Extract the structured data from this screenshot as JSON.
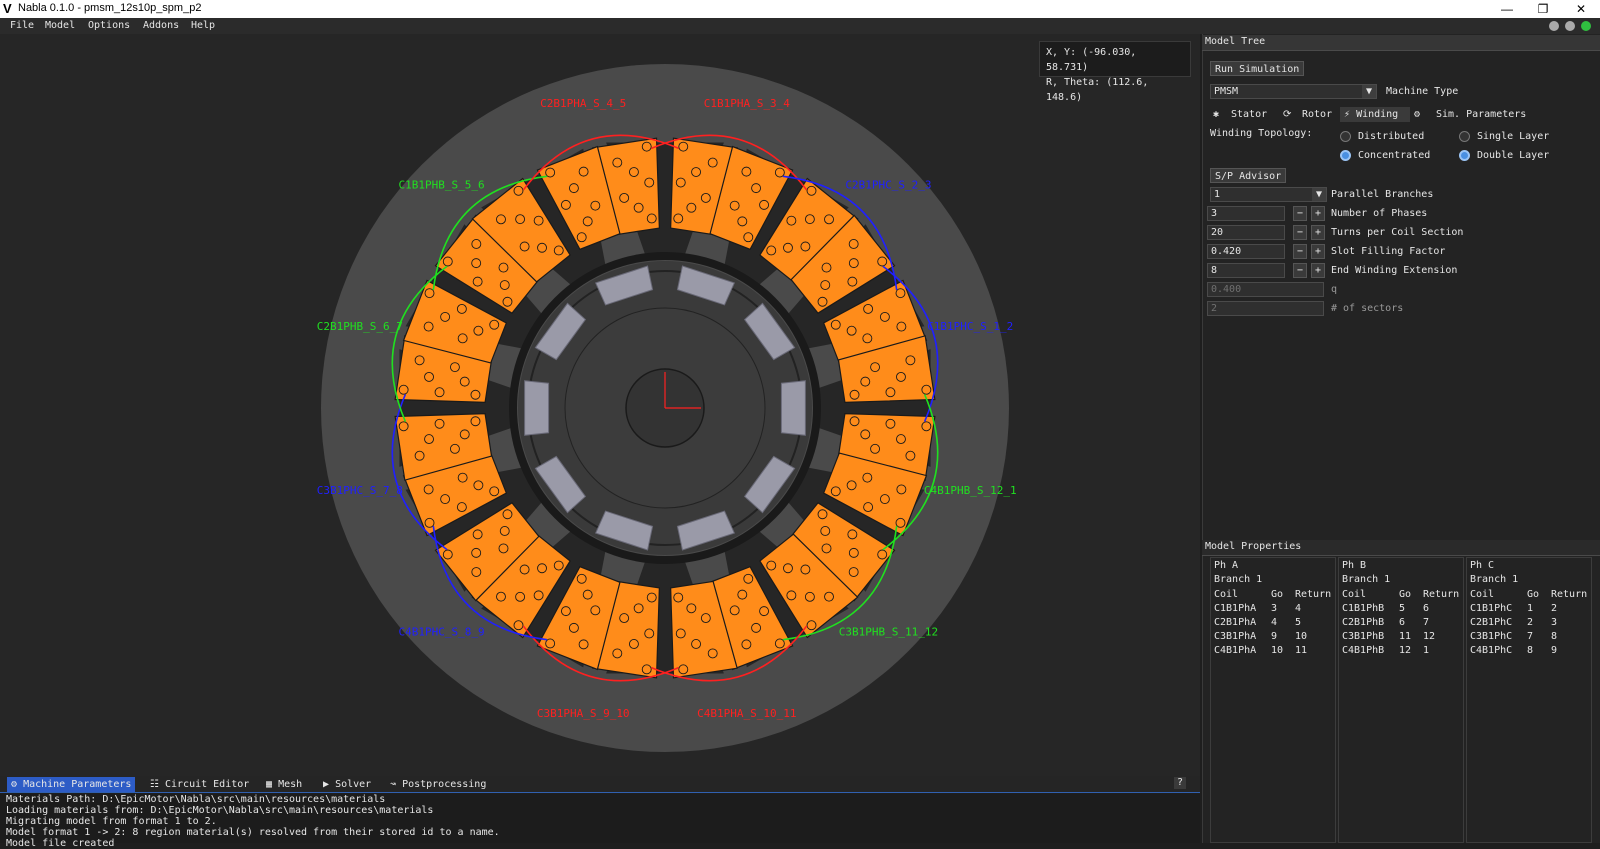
{
  "window": {
    "title": "Nabla 0.1.0 - pmsm_12s10p_spm_p2",
    "logo": "V"
  },
  "menu": [
    "File",
    "Model",
    "Options",
    "Addons",
    "Help"
  ],
  "coords": {
    "xy": "X, Y: (-96.030, 58.731)",
    "rtheta": "R, Theta: (112.6, 148.6)"
  },
  "coils": [
    {
      "label": "C1B1PHA_S_3_4",
      "color": "#ff2020"
    },
    {
      "label": "C2B1PHC_S_2_3",
      "color": "#2020ff"
    },
    {
      "label": "C1B1PHC_S_1_2",
      "color": "#2020ff"
    },
    {
      "label": "C4B1PHB_S_12_1",
      "color": "#20e020"
    },
    {
      "label": "C3B1PHB_S_11_12",
      "color": "#20e020"
    },
    {
      "label": "C4B1PHA_S_10_11",
      "color": "#ff2020"
    },
    {
      "label": "C3B1PHA_S_9_10",
      "color": "#ff2020"
    },
    {
      "label": "C4B1PHC_S_8_9",
      "color": "#2020ff"
    },
    {
      "label": "C3B1PHC_S_7_8",
      "color": "#2020ff"
    },
    {
      "label": "C2B1PHB_S_6_7",
      "color": "#20e020"
    },
    {
      "label": "C1B1PHB_S_5_6",
      "color": "#20e020"
    },
    {
      "label": "C2B1PHA_S_4_5",
      "color": "#ff2020"
    }
  ],
  "model_tree": {
    "title": "Model Tree",
    "run_button": "Run Simulation",
    "machine_type_value": "PMSM",
    "machine_type_label": "Machine Type",
    "tabs": {
      "stator": "Stator",
      "rotor": "Rotor",
      "winding": "Winding",
      "sim": "Sim. Parameters"
    },
    "topology_label": "Winding Topology:",
    "radios": {
      "distributed": "Distributed",
      "concentrated": "Concentrated",
      "single": "Single Layer",
      "double": "Double Layer"
    },
    "sp_advisor": "S/P Advisor",
    "parallel_value": "1",
    "parallel_label": "Parallel Branches",
    "params": [
      {
        "value": "3",
        "label": "Number of Phases"
      },
      {
        "value": "20",
        "label": "Turns per Coil Section"
      },
      {
        "value": "0.420",
        "label": "Slot Filling Factor"
      },
      {
        "value": "8",
        "label": "End Winding Extension"
      }
    ],
    "readonly": [
      {
        "value": "0.400",
        "label": "q"
      },
      {
        "value": "2",
        "label": "# of sectors"
      }
    ]
  },
  "model_properties": {
    "title": "Model Properties",
    "headers": {
      "coil": "Coil",
      "go": "Go",
      "ret": "Return"
    },
    "phases": [
      {
        "name": "Ph A",
        "branch": "Branch 1",
        "rows": [
          [
            "C1B1PhA",
            "3",
            "4"
          ],
          [
            "C2B1PhA",
            "4",
            "5"
          ],
          [
            "C3B1PhA",
            "9",
            "10"
          ],
          [
            "C4B1PhA",
            "10",
            "11"
          ]
        ]
      },
      {
        "name": "Ph B",
        "branch": "Branch 1",
        "rows": [
          [
            "C1B1PhB",
            "5",
            "6"
          ],
          [
            "C2B1PhB",
            "6",
            "7"
          ],
          [
            "C3B1PhB",
            "11",
            "12"
          ],
          [
            "C4B1PhB",
            "12",
            "1"
          ]
        ]
      },
      {
        "name": "Ph C",
        "branch": "Branch 1",
        "rows": [
          [
            "C1B1PhC",
            "1",
            "2"
          ],
          [
            "C2B1PhC",
            "2",
            "3"
          ],
          [
            "C3B1PhC",
            "7",
            "8"
          ],
          [
            "C4B1PhC",
            "8",
            "9"
          ]
        ]
      }
    ]
  },
  "bottom_tabs": [
    "Machine Parameters",
    "Circuit Editor",
    "Mesh",
    "Solver",
    "Postprocessing"
  ],
  "help_button": "?",
  "console": [
    "Materials Path: D:\\EpicMotor\\Nabla\\src\\main\\resources\\materials",
    "Loading materials from: D:\\EpicMotor\\Nabla\\src\\main\\resources\\materials",
    "Migrating model from format 1 to 2.",
    "Model format 1 -> 2: 8 region material(s) resolved from their stored id to a name.",
    "Model file created"
  ],
  "colors": {
    "accent": "#2d5cc6",
    "radio_on": "#4a90e2",
    "coil_fill": "#ff8c1a",
    "stator": "#4a4a4a",
    "rotor": "#3a3a3a",
    "magnet": "#9a9aa8"
  }
}
